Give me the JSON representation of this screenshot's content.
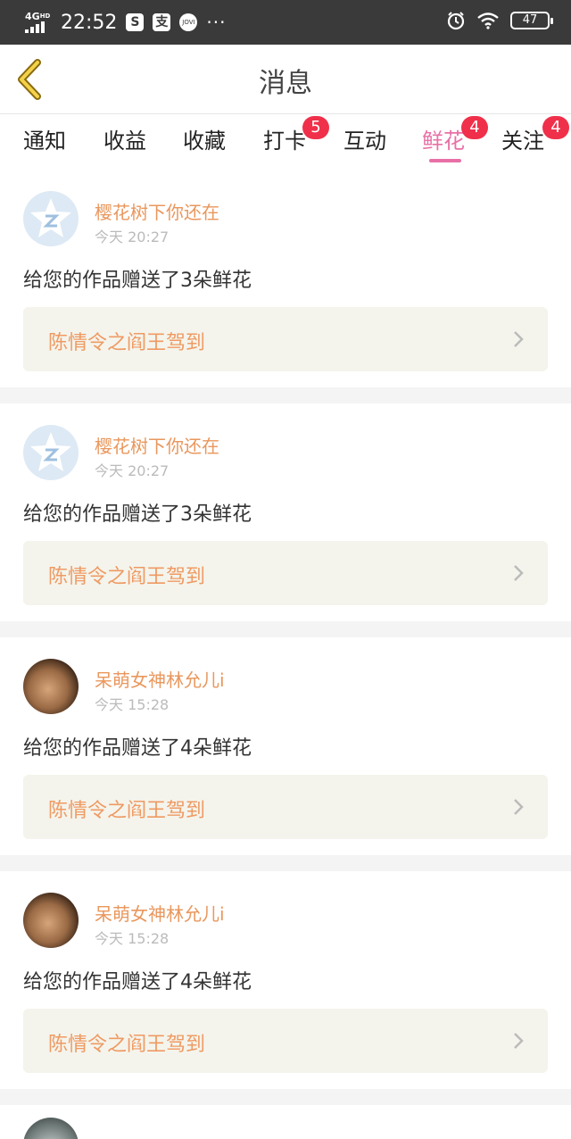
{
  "status_bar": {
    "network": "4G",
    "network_sup": "HD",
    "time": "22:52",
    "app_icon_1": "S",
    "app_icon_2": "支",
    "app_icon_3": "JOVI",
    "more": "···",
    "battery": "47"
  },
  "header": {
    "title": "消息",
    "back_icon": "chevron-left-icon"
  },
  "tabs": [
    {
      "label": "通知"
    },
    {
      "label": "收益"
    },
    {
      "label": "收藏"
    },
    {
      "label": "打卡",
      "badge": "5"
    },
    {
      "label": "互动"
    },
    {
      "label": "鲜花",
      "badge": "4",
      "active": true
    },
    {
      "label": "关注",
      "badge": "4"
    }
  ],
  "colors": {
    "accent": "#e870a6",
    "badge": "#f0304a",
    "username": "#e9975d",
    "work_title": "#ef9a63"
  },
  "feed": [
    {
      "user": "樱花树下你还在",
      "time": "今天 20:27",
      "message": "给您的作品赠送了3朵鲜花",
      "work": "陈情令之阎王驾到",
      "avatar": "default-avatar"
    },
    {
      "user": "樱花树下你还在",
      "time": "今天 20:27",
      "message": "给您的作品赠送了3朵鲜花",
      "work": "陈情令之阎王驾到",
      "avatar": "default-avatar"
    },
    {
      "user": "呆萌女神林允儿i",
      "time": "今天 15:28",
      "message": "给您的作品赠送了4朵鲜花",
      "work": "陈情令之阎王驾到",
      "avatar": "photo-avatar"
    },
    {
      "user": "呆萌女神林允儿i",
      "time": "今天 15:28",
      "message": "给您的作品赠送了4朵鲜花",
      "work": "陈情令之阎王驾到",
      "avatar": "photo-avatar"
    }
  ]
}
